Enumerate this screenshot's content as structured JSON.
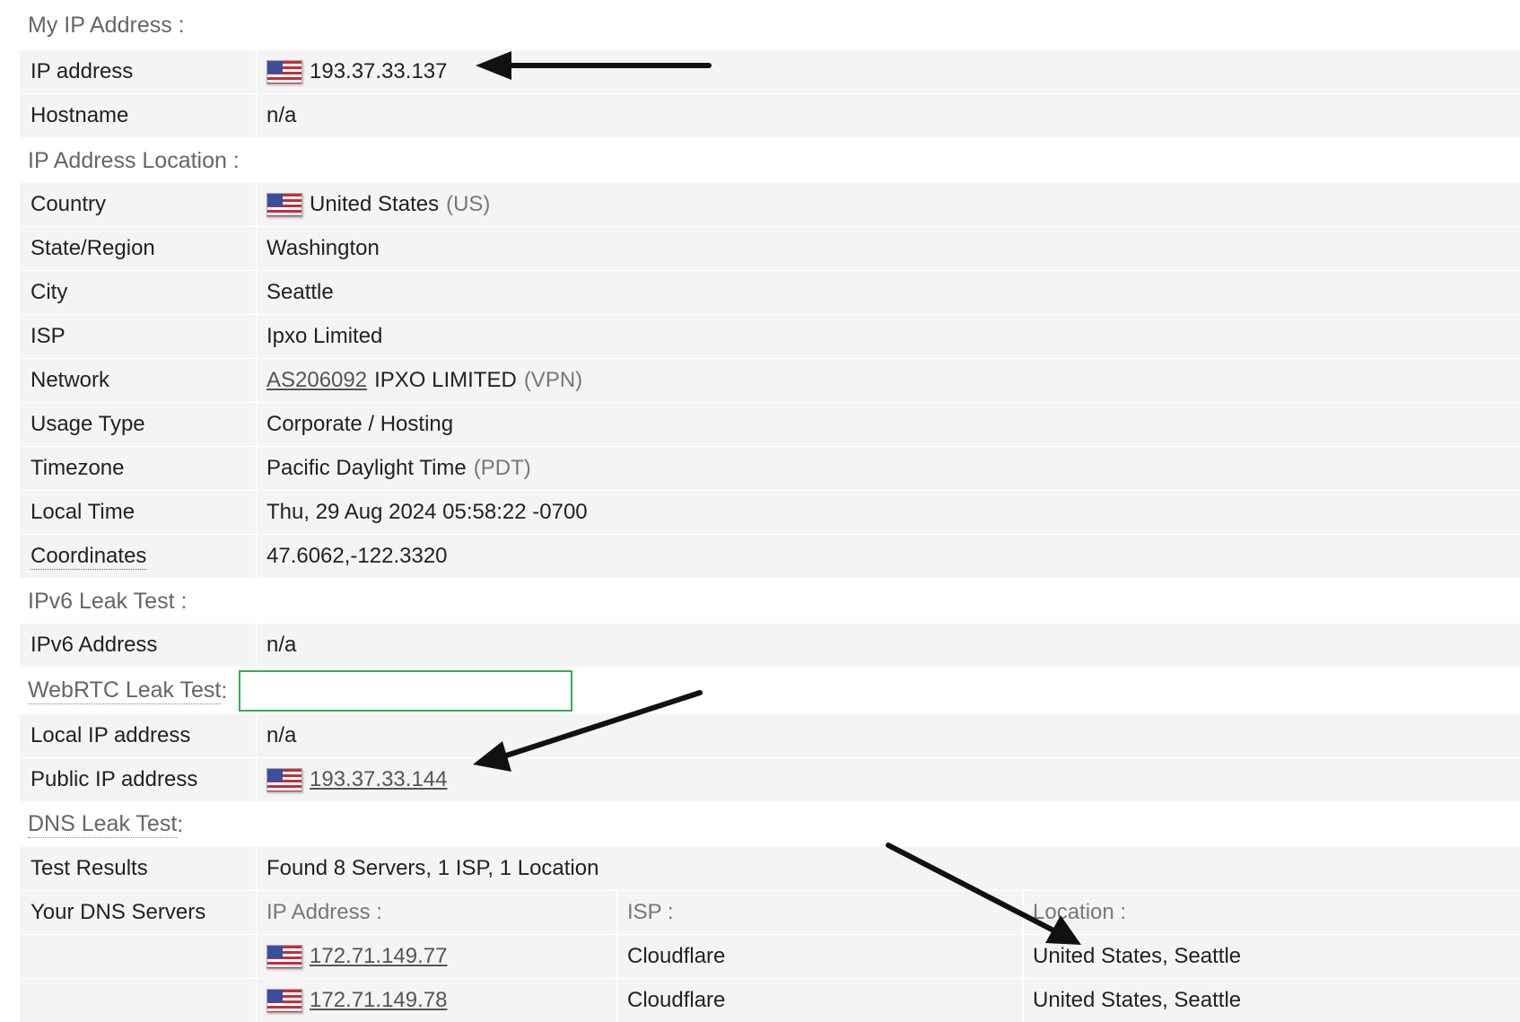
{
  "my_ip": {
    "section_title": "My IP Address :",
    "rows": [
      {
        "label": "IP address",
        "value": "193.37.33.137"
      },
      {
        "label": "Hostname",
        "value": "n/a"
      }
    ]
  },
  "location": {
    "section_title": "IP Address Location :",
    "country": {
      "label": "Country",
      "value": "United States",
      "extra": "(US)"
    },
    "state": {
      "label": "State/Region",
      "value": "Washington"
    },
    "city": {
      "label": "City",
      "value": "Seattle"
    },
    "isp": {
      "label": "ISP",
      "value": "Ipxo Limited"
    },
    "network": {
      "label": "Network",
      "asn": "AS206092",
      "value": "IPXO LIMITED",
      "extra": "(VPN)"
    },
    "usage": {
      "label": "Usage Type",
      "value": "Corporate / Hosting"
    },
    "timezone": {
      "label": "Timezone",
      "value": "Pacific Daylight Time",
      "extra": "(PDT)"
    },
    "local_time": {
      "label": "Local Time",
      "value": "Thu, 29 Aug 2024 05:58:22 -0700"
    },
    "coordinates": {
      "label": "Coordinates",
      "value": "47.6062,-122.3320"
    }
  },
  "ipv6": {
    "section_title": "IPv6 Leak Test :",
    "address": {
      "label": "IPv6 Address",
      "value": "n/a"
    }
  },
  "webrtc": {
    "section_title": "WebRTC Leak Test",
    "colon": " :",
    "local": {
      "label": "Local IP address",
      "value": "n/a"
    },
    "public": {
      "label": "Public IP address",
      "value": "193.37.33.144"
    }
  },
  "dns": {
    "section_title": "DNS Leak Test",
    "colon": " :",
    "results": {
      "label": "Test Results",
      "value": "Found 8 Servers, 1 ISP, 1 Location"
    },
    "servers_label": "Your DNS Servers",
    "headers": {
      "ip": "IP Address :",
      "isp": "ISP :",
      "location": "Location :"
    },
    "servers": [
      {
        "ip": "172.71.149.77",
        "isp": "Cloudflare",
        "location": "United States, Seattle"
      },
      {
        "ip": "172.71.149.78",
        "isp": "Cloudflare",
        "location": "United States, Seattle"
      }
    ]
  },
  "icons": {
    "flag": "us-flag-icon",
    "arrow": "arrow-annotation-icon"
  },
  "colors": {
    "highlight_box": "#3aaa55",
    "row_bg": "#f4f4f4"
  }
}
